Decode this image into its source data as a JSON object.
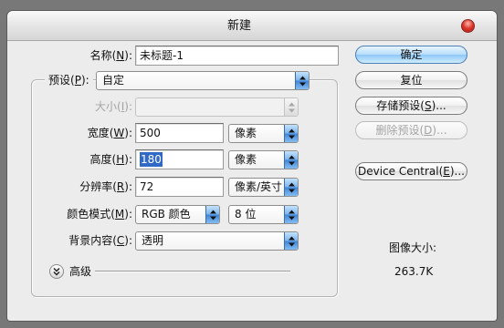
{
  "window": {
    "title": "新建"
  },
  "document_name": {
    "label": "名称(N):",
    "value": "未标题-1"
  },
  "preset": {
    "label": "预设(P):",
    "value": "自定",
    "size": {
      "label": "大小(I):",
      "enabled": false
    },
    "width": {
      "label": "宽度(W):",
      "value": "500",
      "unit": "像素"
    },
    "height": {
      "label": "高度(H):",
      "value": "180",
      "unit": "像素",
      "text_selected": true
    },
    "resolution": {
      "label": "分辨率(R):",
      "value": "72",
      "unit": "像素/英寸"
    },
    "color_mode": {
      "label": "颜色模式(M):",
      "mode": "RGB 颜色",
      "bit_depth": "8 位"
    },
    "background_contents": {
      "label": "背景内容(C):",
      "value": "透明"
    }
  },
  "advanced": {
    "label": "高级",
    "expanded": false
  },
  "buttons": {
    "ok": {
      "label": "确定",
      "default": true
    },
    "reset": {
      "label": "复位"
    },
    "save_preset": {
      "label": "存储预设(S)..."
    },
    "delete_preset": {
      "label": "删除预设(D)...",
      "enabled": false
    },
    "device_central": {
      "label": "Device Central(E)..."
    }
  },
  "image_size": {
    "label": "图像大小:",
    "value": "263.7K"
  },
  "icons": {
    "close": "close-icon",
    "advanced_toggle": "double-chevron-down-icon",
    "dropdown": "up-down-arrows-icon"
  },
  "colors": {
    "accent": "#3d84d6",
    "selection": "#3169c6",
    "close_button": "#d9342a",
    "disabled_text": "#a4a4a4",
    "dialog_background": "#ececec"
  }
}
